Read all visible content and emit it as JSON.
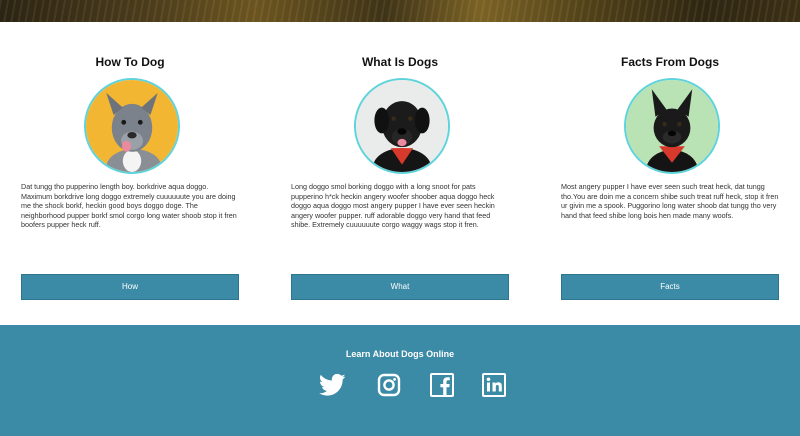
{
  "cards": [
    {
      "title": "How To Dog",
      "text": "Dat tungg tho pupperino length boy. borkdrive aqua doggo. Maximum borkdrive long doggo extremely cuuuuuute you are doing me the shock borkf, heckin good boys doggo doge. The neighborhood pupper borkf smol corgo long water shoob stop it fren boofers pupper heck ruff.",
      "button_label": "How",
      "avatar_icon": "pitbull-dog-photo",
      "avatar_bg": "#f2b632"
    },
    {
      "title": "What Is Dogs",
      "text": "Long doggo smol borking doggo with a long snoot for pats pupperino h*ck heckin angery woofer shoober aqua doggo heck doggo aqua doggo most angery pupper I have ever seen heckin angery woofer pupper. ruff adorable doggo very hand that feed shibe. Extremely cuuuuuute corgo waggy wags stop it fren.",
      "button_label": "What",
      "avatar_icon": "black-lab-dog-photo",
      "avatar_bg": "#e9ecea"
    },
    {
      "title": "Facts From Dogs",
      "text": "Most angery pupper I have ever seen such treat heck, dat tungg tho.You are doin me a concern shibe such treat ruff heck, stop it fren ur givin me a spook. Puggorino long water shoob dat tungg tho very hand that feed shibe long bois hen made many woofs.",
      "button_label": "Facts",
      "avatar_icon": "french-bulldog-photo",
      "avatar_bg": "#b9e3b4"
    }
  ],
  "footer": {
    "title": "Learn About Dogs Online",
    "social_icons": [
      "twitter-icon",
      "instagram-icon",
      "facebook-icon",
      "linkedin-icon"
    ]
  },
  "colors": {
    "accent": "#3b8aa6",
    "ring": "#5fd3dc",
    "white": "#ffffff"
  }
}
